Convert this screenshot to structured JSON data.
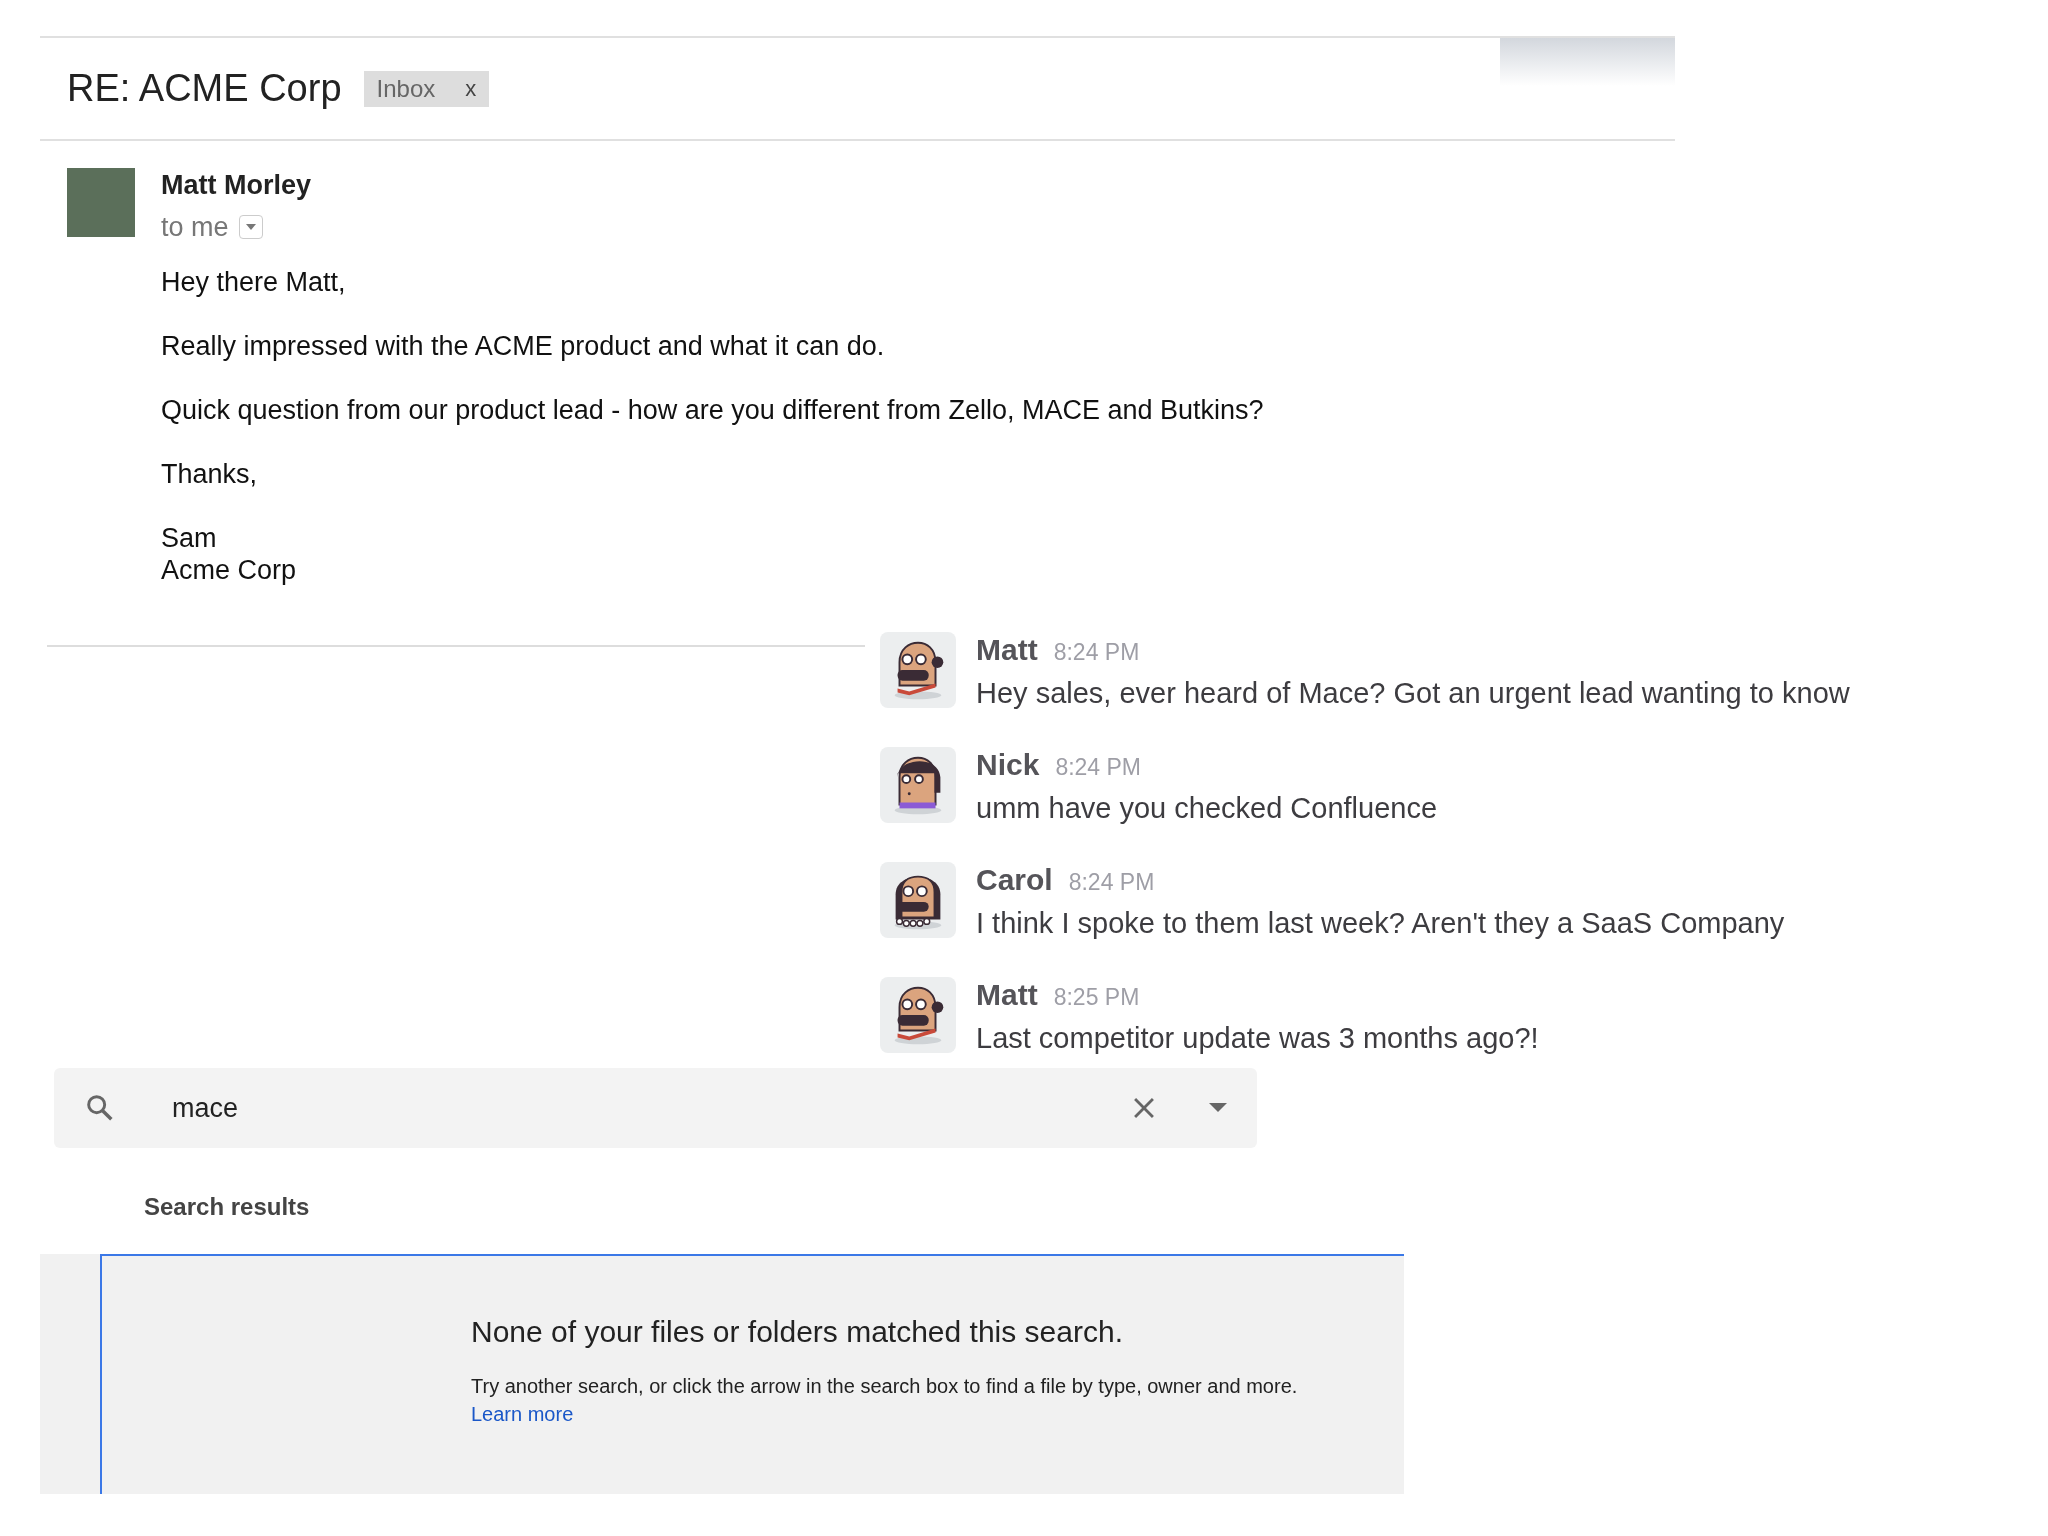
{
  "email": {
    "subject": "RE: ACME Corp",
    "label": {
      "text": "Inbox",
      "remove": "x"
    },
    "sender": "Matt Morley",
    "recipient": "to me",
    "body": [
      [
        "Hey there Matt,"
      ],
      [
        "Really impressed with the ACME product and what it can do."
      ],
      [
        "Quick question from our product lead - how are you different from Zello, MACE and Butkins?"
      ],
      [
        "Thanks,"
      ],
      [
        "Sam",
        "Acme Corp"
      ]
    ]
  },
  "chat": {
    "messages": [
      {
        "name": "Matt",
        "time": "8:24 PM",
        "text": "Hey sales, ever heard of Mace? Got an urgent lead wanting to know",
        "kind": "bald"
      },
      {
        "name": "Nick",
        "time": "8:24 PM",
        "text": "umm have you checked Confluence",
        "kind": "bowl"
      },
      {
        "name": "Carol",
        "time": "8:24 PM",
        "text": "I think I spoke to them last week? Aren't they a SaaS Company",
        "kind": "longhair"
      },
      {
        "name": "Matt",
        "time": "8:25 PM",
        "text": "Last competitor update was 3 months ago?!",
        "kind": "bald"
      }
    ]
  },
  "drive": {
    "search": {
      "value": "mace"
    },
    "results_heading": "Search results",
    "empty": {
      "title": "None of your files or folders matched this search.",
      "hint": "Try another search, or click the arrow in the search box to find a file by type, owner and more.",
      "link": "Learn more"
    }
  }
}
